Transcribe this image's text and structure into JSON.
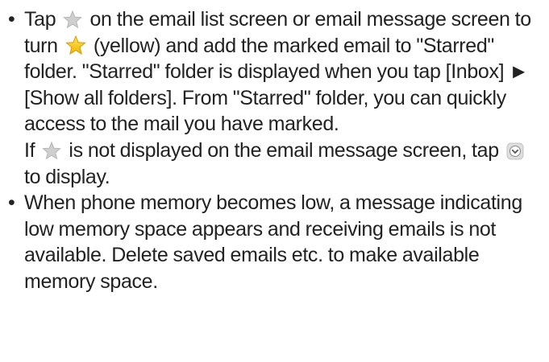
{
  "bullets": [
    {
      "p1": "Tap",
      "p2": "on the email list screen or email message screen to turn",
      "p3": "(yellow) and add the marked email to \"Starred\" folder. \"Starred\" folder is displayed when you tap [Inbox] ► [Show all folders]. From \"Starred\" folder, you can quickly access to the mail you have marked.",
      "p4": "If",
      "p5": "is not displayed on the email message screen, tap",
      "p6": "to display."
    },
    {
      "text": "When phone memory becomes low, a message indicating low memory space appears and receiving emails is not available. Delete saved emails etc. to make available memory space."
    }
  ],
  "icons": {
    "star_off": "star-outline-icon",
    "star_on": "star-yellow-icon",
    "expand": "chevron-down-circle-icon"
  },
  "colors": {
    "text": "#222222",
    "star_off": "#c8c8c8",
    "star_on": "#f5c518",
    "expand_bg": "#d9d9d9",
    "expand_fg": "#4a4a4a"
  }
}
